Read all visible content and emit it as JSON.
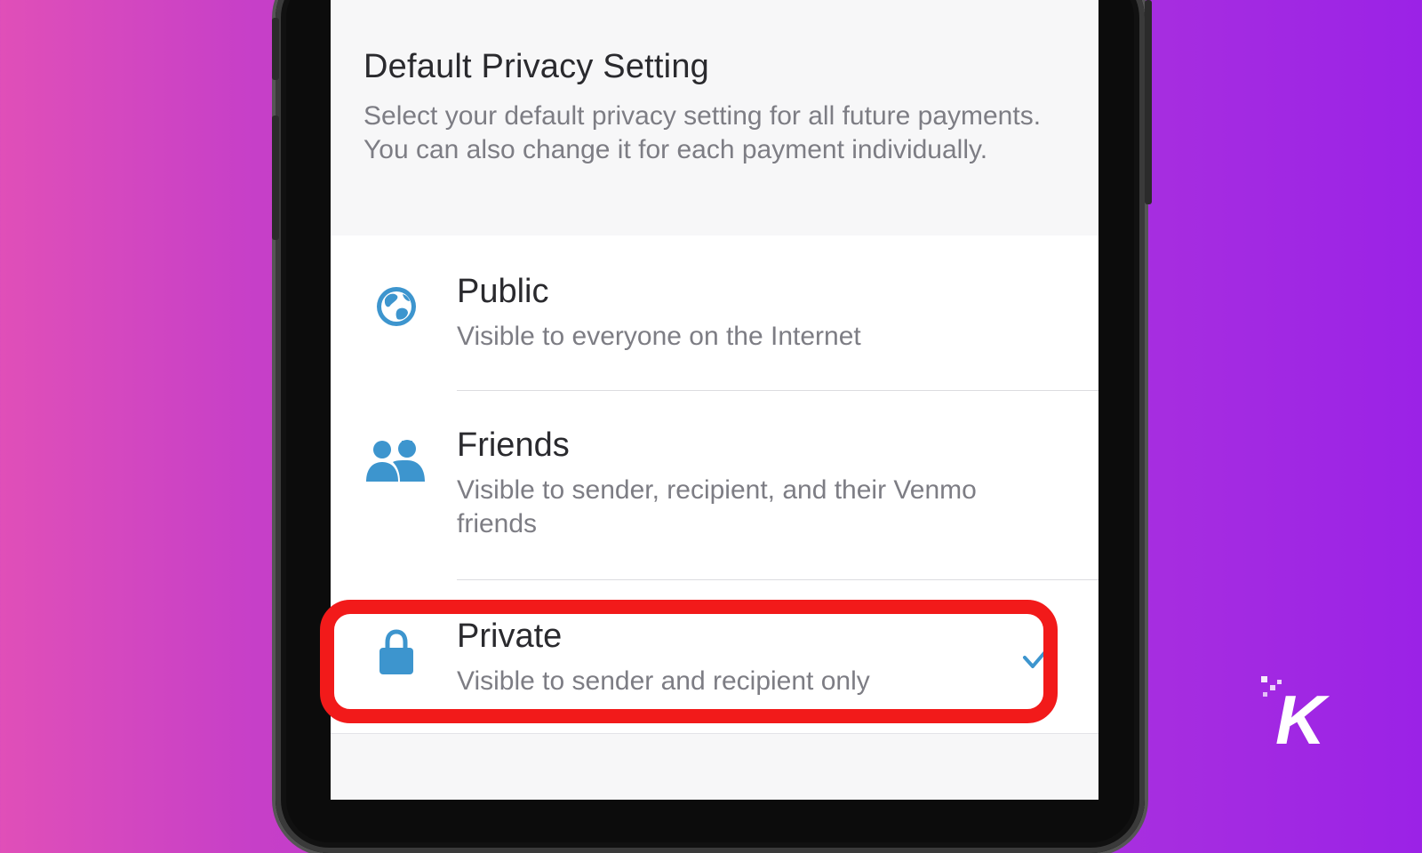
{
  "page": {
    "title": "Default Privacy Setting",
    "description": "Select your default privacy setting for all future payments. You can also change it for each payment individually."
  },
  "options": [
    {
      "icon": "globe-icon",
      "label": "Public",
      "sublabel": "Visible to everyone on the Internet",
      "selected": false
    },
    {
      "icon": "friends-icon",
      "label": "Friends",
      "sublabel": "Visible to sender, recipient, and their Venmo friends",
      "selected": false
    },
    {
      "icon": "lock-icon",
      "label": "Private",
      "sublabel": "Visible to sender and recipient only",
      "selected": true
    }
  ],
  "colors": {
    "accent": "#3d95ce",
    "highlight": "#f21a1a",
    "background_left": "#e04fb8",
    "background_right": "#9b22e6"
  },
  "brand_logo": "K"
}
